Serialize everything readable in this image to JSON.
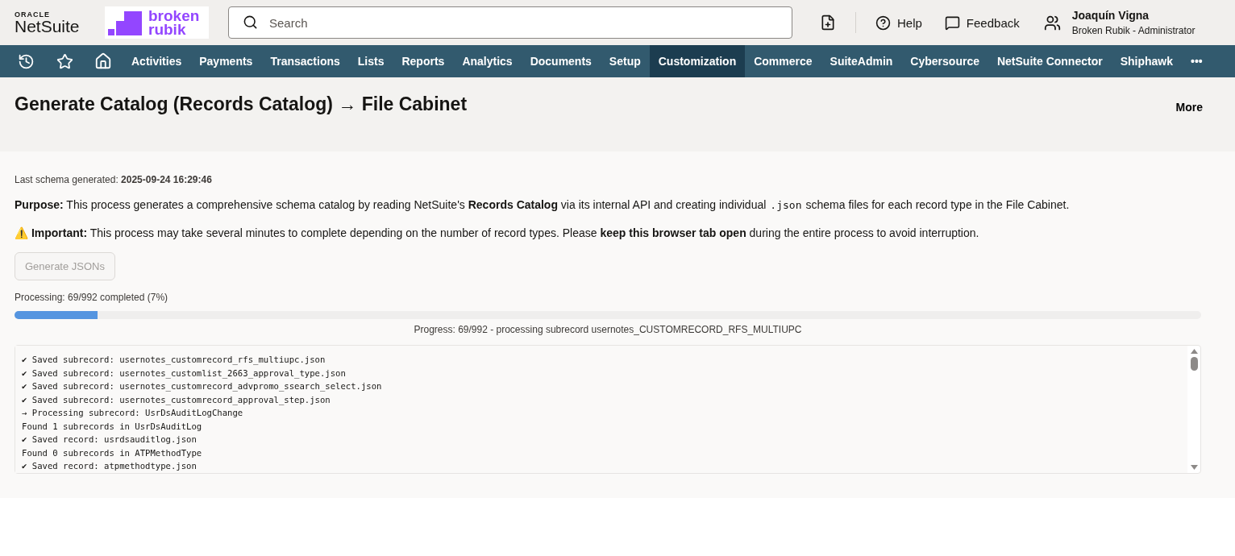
{
  "header": {
    "oracle_label": "ORACLE",
    "product_name": "NetSuite",
    "brand_logo": [
      "broken",
      "rubik"
    ],
    "search": {
      "placeholder": "Search"
    },
    "help": "Help",
    "feedback": "Feedback",
    "user": {
      "name": "Joaquín Vigna",
      "role": "Broken Rubik - Administrator"
    }
  },
  "nav": {
    "items": [
      {
        "label": "Activities",
        "selected": false
      },
      {
        "label": "Payments",
        "selected": false
      },
      {
        "label": "Transactions",
        "selected": false
      },
      {
        "label": "Lists",
        "selected": false
      },
      {
        "label": "Reports",
        "selected": false
      },
      {
        "label": "Analytics",
        "selected": false
      },
      {
        "label": "Documents",
        "selected": false
      },
      {
        "label": "Setup",
        "selected": false
      },
      {
        "label": "Customization",
        "selected": true
      },
      {
        "label": "Commerce",
        "selected": false
      },
      {
        "label": "SuiteAdmin",
        "selected": false
      },
      {
        "label": "Cybersource",
        "selected": false
      },
      {
        "label": "NetSuite Connector",
        "selected": false
      },
      {
        "label": "Shiphawk",
        "selected": false
      }
    ],
    "more": "•••"
  },
  "page": {
    "title": "Generate Catalog (Records Catalog) → File Cabinet",
    "more": "More"
  },
  "content": {
    "last_generated": "Last schema generated: **2025-09-24 16:29:46**",
    "purpose": {
      "before": "**Purpose:** This process generates a comprehensive schema catalog by reading NetSuite's **Records Catalog** via its internal API and creating individual",
      "code": ".json",
      "after": "schema files for each record type in the File Cabinet."
    },
    "important": {
      "icon": "⚠️",
      "text": "**Important:** This process may take several minutes to complete depending on the number of record types. Please **keep this browser tab open** during the entire process to avoid interruption."
    },
    "generate_button": {
      "label": "Generate JSONs",
      "disabled": true
    },
    "processing": "Processing: 69/992 completed (7%)",
    "progress": {
      "level": 0.07,
      "caption": "Progress: 69/992 - processing subrecord usernotes_CUSTOMRECORD_RFS_MULTIUPC"
    },
    "log": [
      "✔ Saved subrecord: usernotes_customrecord_rfs_multiupc.json",
      "✔ Saved subrecord: usernotes_customlist_2663_approval_type.json",
      "✔ Saved subrecord: usernotes_customrecord_advpromo_ssearch_select.json",
      "✔ Saved subrecord: usernotes_customrecord_approval_step.json",
      "→ Processing subrecord: UsrDsAuditLogChange",
      "Found 1 subrecords in UsrDsAuditLog",
      "✔ Saved record: usrdsauditlog.json",
      "Found 0 subrecords in ATPMethodType",
      "✔ Saved record: atpmethodtype.json"
    ]
  }
}
